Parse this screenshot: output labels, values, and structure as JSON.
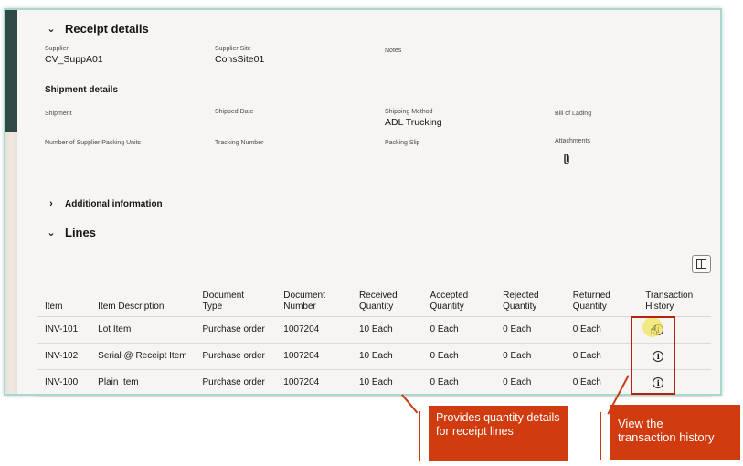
{
  "receipt_details": {
    "title": "Receipt details",
    "supplier_label": "Supplier",
    "supplier_value": "CV_SuppA01",
    "supplier_site_label": "Supplier Site",
    "supplier_site_value": "ConsSite01",
    "notes_label": "Notes"
  },
  "shipment": {
    "title": "Shipment details",
    "shipment_label": "Shipment",
    "shipped_date_label": "Shipped Date",
    "shipping_method_label": "Shipping Method",
    "shipping_method_value": "ADL Trucking",
    "bill_of_lading_label": "Bill of Lading",
    "packing_units_label": "Number of Supplier Packing Units",
    "tracking_number_label": "Tracking Number",
    "packing_slip_label": "Packing Slip",
    "attachments_label": "Attachments",
    "attachment_icon": "paperclip-icon"
  },
  "additional_info": {
    "title": "Additional information"
  },
  "lines": {
    "title": "Lines",
    "columns": [
      "Item",
      "Item Description",
      "Document Type",
      "Document Number",
      "Received Quantity",
      "Accepted Quantity",
      "Rejected Quantity",
      "Returned Quantity",
      "Transaction History"
    ],
    "column_lines": [
      [
        "Item",
        ""
      ],
      [
        "Item Description",
        ""
      ],
      [
        "Document",
        "Type"
      ],
      [
        "Document",
        "Number"
      ],
      [
        "Received",
        "Quantity"
      ],
      [
        "Accepted",
        "Quantity"
      ],
      [
        "Rejected",
        "Quantity"
      ],
      [
        "Returned",
        "Quantity"
      ],
      [
        "Transaction",
        "History"
      ]
    ],
    "rows": [
      {
        "item": "INV-101",
        "description": "Lot Item",
        "doc_type": "Purchase order",
        "doc_number": "1007204",
        "received": "10 Each",
        "accepted": "0 Each",
        "rejected": "0 Each",
        "returned": "0 Each",
        "history_icon": "info-icon"
      },
      {
        "item": "INV-102",
        "description": "Serial @ Receipt Item",
        "doc_type": "Purchase order",
        "doc_number": "1007204",
        "received": "10 Each",
        "accepted": "0 Each",
        "rejected": "0 Each",
        "returned": "0 Each",
        "history_icon": "info-icon"
      },
      {
        "item": "INV-100",
        "description": "Plain Item",
        "doc_type": "Purchase order",
        "doc_number": "1007204",
        "received": "10 Each",
        "accepted": "0 Each",
        "rejected": "0 Each",
        "returned": "0 Each",
        "history_icon": "info-icon"
      }
    ]
  },
  "callouts": {
    "quantity": "Provides quantity details for receipt lines",
    "history_line1": "View the",
    "history_line2": "transaction history"
  },
  "colors": {
    "callout_bg": "#d03c0f",
    "highlight_border": "#b7220f",
    "frame_border": "#a9d7cc",
    "sidebar": "#2f4a45"
  }
}
